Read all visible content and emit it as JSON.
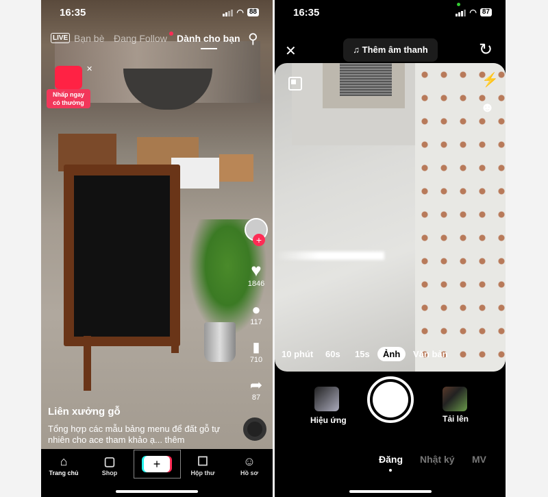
{
  "left": {
    "status": {
      "time": "16:35",
      "battery": "88"
    },
    "top_tabs": {
      "live": "LIVE",
      "friends": "Bạn bè",
      "following": "Đang Follow",
      "for_you": "Dành cho bạn"
    },
    "promo": {
      "line1": "Nhấp ngay",
      "line2": "có thưởng"
    },
    "actions": {
      "likes": "1846",
      "comments": "117",
      "saves": "710",
      "shares": "87"
    },
    "caption": {
      "user": "Liên xưởng gỗ",
      "text": "Tổng hợp các mẫu bảng menu để đất gỗ tự nhiên cho ace tham khảo ạ... thêm"
    },
    "nav": {
      "home": "Trang chủ",
      "shop": "Shop",
      "create": "+",
      "inbox": "Hộp thư",
      "profile": "Hồ sơ"
    }
  },
  "right": {
    "status": {
      "time": "16:35",
      "battery": "87"
    },
    "add_sound": "Thêm âm thanh",
    "modes": [
      "10 phút",
      "60s",
      "15s",
      "Ảnh",
      "Văn bản"
    ],
    "selected_mode": "Ảnh",
    "effects": "Hiệu ứng",
    "upload": "Tải lên",
    "bottom_tabs": [
      "Đăng",
      "Nhật ký",
      "MV"
    ],
    "active_bottom_tab": "Đăng"
  },
  "colors": {
    "accent": "#fe2c55",
    "cyan": "#25f4ee"
  }
}
